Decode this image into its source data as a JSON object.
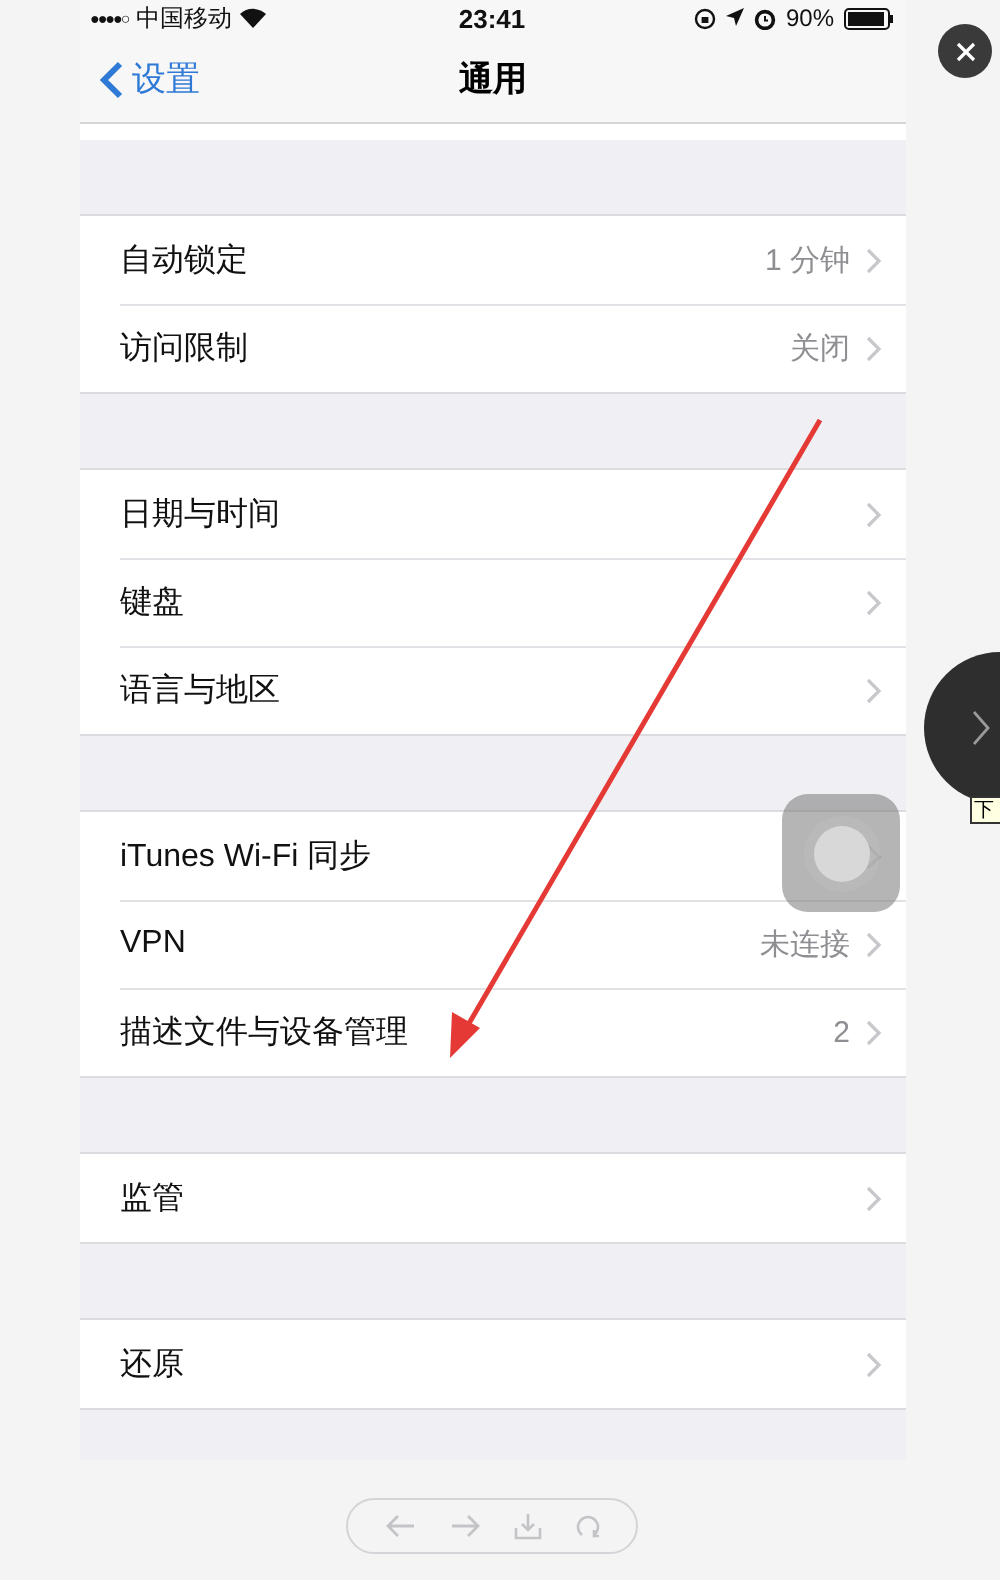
{
  "status_bar": {
    "signal": "●●●●○",
    "carrier": "中国移动",
    "time": "23:41",
    "battery": "90%"
  },
  "nav": {
    "back": "设置",
    "title": "通用"
  },
  "groups": [
    {
      "rows": [
        {
          "label": "自动锁定",
          "value": "1 分钟"
        },
        {
          "label": "访问限制",
          "value": "关闭"
        }
      ]
    },
    {
      "rows": [
        {
          "label": "日期与时间"
        },
        {
          "label": "键盘"
        },
        {
          "label": "语言与地区"
        }
      ]
    },
    {
      "rows": [
        {
          "label": "iTunes Wi-Fi 同步"
        },
        {
          "label": "VPN",
          "value": "未连接"
        },
        {
          "label": "描述文件与设备管理",
          "value": "2"
        }
      ]
    },
    {
      "rows": [
        {
          "label": "监管"
        }
      ]
    },
    {
      "rows": [
        {
          "label": "还原"
        }
      ]
    }
  ],
  "viewer": {
    "next_tooltip": "下"
  }
}
